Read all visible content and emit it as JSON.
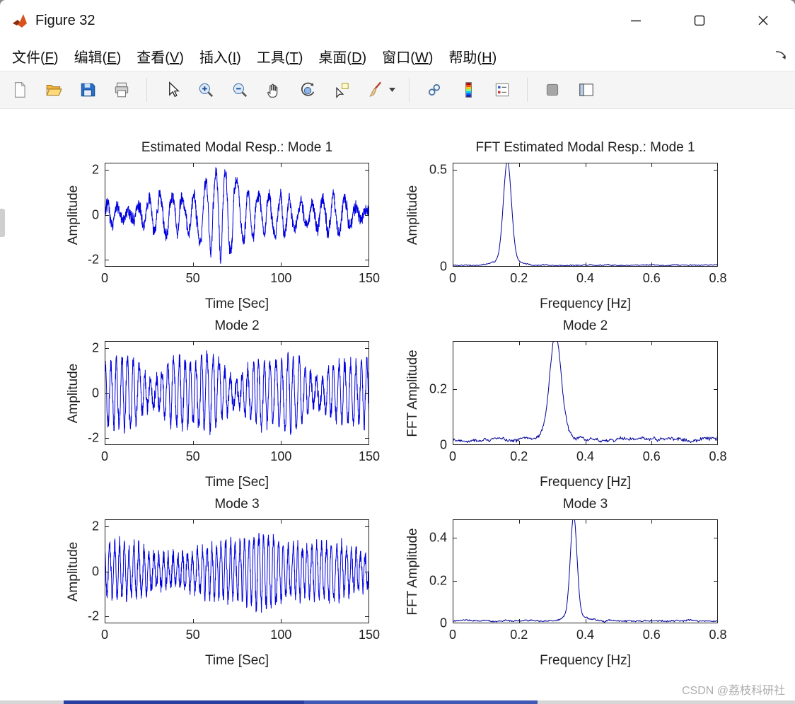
{
  "window": {
    "title": "Figure 32",
    "controls": [
      {
        "name": "minimize-button"
      },
      {
        "name": "maximize-button"
      },
      {
        "name": "close-button"
      }
    ]
  },
  "menu": {
    "items": [
      {
        "name": "menu-item-file",
        "label": "文件(F)"
      },
      {
        "name": "menu-item-edit",
        "label": "编辑(E)"
      },
      {
        "name": "menu-item-view",
        "label": "查看(V)"
      },
      {
        "name": "menu-item-insert",
        "label": "插入(I)"
      },
      {
        "name": "menu-item-tools",
        "label": "工具(T)"
      },
      {
        "name": "menu-item-desktop",
        "label": "桌面(D)"
      },
      {
        "name": "menu-item-window",
        "label": "窗口(W)"
      },
      {
        "name": "menu-item-help",
        "label": "帮助(H)"
      }
    ]
  },
  "toolbar": {
    "items": [
      "new-figure-icon",
      "open-file-icon",
      "save-figure-icon",
      "print-figure-icon",
      "separator",
      "edit-plot-icon",
      "zoom-in-icon",
      "zoom-out-icon",
      "pan-icon",
      "rotate-3d-icon",
      "data-cursor-icon",
      "brush-icon",
      "brush-dropdown-icon",
      "separator",
      "link-plot-icon",
      "insert-colorbar-icon",
      "insert-legend-icon",
      "separator",
      "hide-plot-tools-icon",
      "show-plot-tools-icon"
    ]
  },
  "watermark": {
    "text": "CSDN @荔枝科研社"
  },
  "colors": {
    "axis": "#202020",
    "time_line": "#0000e0",
    "fft_line": "#000099"
  },
  "chart_data": [
    {
      "id": "mode1-time",
      "type": "line",
      "title": "Estimated Modal Resp.: Mode 1",
      "xlabel": "Time [Sec]",
      "ylabel": "Amplitude",
      "xlim": [
        0,
        150
      ],
      "ylim": [
        -2.3,
        2.3
      ],
      "xticks": [
        0,
        50,
        100,
        150
      ],
      "yticks": [
        -2,
        0,
        2
      ],
      "line_color": "#0000e0",
      "signal": {
        "freq_hz": 0.165,
        "seed": 7,
        "noise": 0.34,
        "dt": 0.1,
        "envelope": {
          "base": 0.55,
          "sin": [
            {
              "freq": 0.03,
              "amp": 0.22,
              "phase": 2.0
            },
            {
              "freq": 0.013,
              "amp": 0.18,
              "phase": 4.5
            }
          ],
          "gauss": [
            {
              "center": 70,
              "sigma": 13,
              "amp": 1.3
            }
          ]
        }
      }
    },
    {
      "id": "mode1-fft",
      "type": "line",
      "title": "FFT Estimated Modal Resp.: Mode 1",
      "xlabel": "Frequency [Hz]",
      "ylabel": "Amplitude",
      "xlim": [
        0,
        0.8
      ],
      "ylim": [
        0,
        0.535
      ],
      "xticks": [
        0,
        0.2,
        0.4,
        0.6,
        0.8
      ],
      "yticks": [
        0,
        0.5
      ],
      "line_color": "#000099",
      "spectrum": {
        "peak_hz": 0.165,
        "peak_amp": 0.51,
        "sigma": 0.012,
        "floor": 0.008,
        "floor_noise": 0.005,
        "seed": 21
      }
    },
    {
      "id": "mode2-time",
      "type": "line",
      "title": "Mode 2",
      "xlabel": "Time [Sec]",
      "ylabel": "Amplitude",
      "xlim": [
        0,
        150
      ],
      "ylim": [
        -2.3,
        2.3
      ],
      "xticks": [
        0,
        50,
        100,
        150
      ],
      "yticks": [
        -2,
        0,
        2
      ],
      "line_color": "#0000e0",
      "signal": {
        "freq_hz": 0.31,
        "seed": 8,
        "noise": 0.4,
        "dt": 0.1,
        "envelope": {
          "base": 1.2,
          "sin": [
            {
              "freq": 0.021,
              "amp": 0.4,
              "phase": 1.0
            },
            {
              "freq": 0.043,
              "amp": 0.25,
              "phase": 3.8
            }
          ],
          "gauss": []
        }
      }
    },
    {
      "id": "mode2-fft",
      "type": "line",
      "title": "Mode 2",
      "xlabel": "Frequency [Hz]",
      "ylabel": "FFT Amplitude",
      "xlim": [
        0,
        0.8
      ],
      "ylim": [
        0,
        0.37
      ],
      "xticks": [
        0,
        0.2,
        0.4,
        0.6,
        0.8
      ],
      "yticks": [
        0,
        0.2
      ],
      "line_color": "#000099",
      "spectrum": {
        "peak_hz": 0.31,
        "peak_amp": 0.355,
        "sigma": 0.017,
        "floor": 0.02,
        "floor_noise": 0.01,
        "seed": 22
      }
    },
    {
      "id": "mode3-time",
      "type": "line",
      "title": "Mode 3",
      "xlabel": "Time [Sec]",
      "ylabel": "Amplitude",
      "xlim": [
        0,
        150
      ],
      "ylim": [
        -2.3,
        2.3
      ],
      "xticks": [
        0,
        50,
        100,
        150
      ],
      "yticks": [
        -2,
        0,
        2
      ],
      "line_color": "#0000e0",
      "signal": {
        "freq_hz": 0.365,
        "seed": 9,
        "noise": 0.42,
        "dt": 0.1,
        "envelope": {
          "base": 0.9,
          "sin": [
            {
              "freq": 0.017,
              "amp": 0.3,
              "phase": 0.6
            }
          ],
          "gauss": [
            {
              "center": 93,
              "sigma": 10,
              "amp": 0.85
            }
          ]
        }
      }
    },
    {
      "id": "mode3-fft",
      "type": "line",
      "title": "Mode 3",
      "xlabel": "Frequency [Hz]",
      "ylabel": "FFT Amplitude",
      "xlim": [
        0,
        0.8
      ],
      "ylim": [
        0,
        0.486
      ],
      "xticks": [
        0,
        0.2,
        0.4,
        0.6,
        0.8
      ],
      "yticks": [
        0,
        0.2,
        0.4
      ],
      "line_color": "#000099",
      "spectrum": {
        "peak_hz": 0.365,
        "peak_amp": 0.468,
        "sigma": 0.01,
        "floor": 0.012,
        "floor_noise": 0.006,
        "seed": 23
      }
    }
  ]
}
